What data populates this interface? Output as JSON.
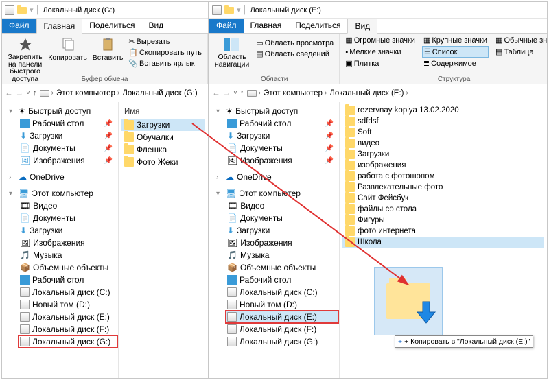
{
  "win1": {
    "title": "Локальный диск (G:)",
    "tabs": {
      "file": "Файл",
      "home": "Главная",
      "share": "Поделиться",
      "view": "Вид"
    },
    "ribbon": {
      "pin": "Закрепить на панели\nбыстрого доступа",
      "copy": "Копировать",
      "paste": "Вставить",
      "cut": "Вырезать",
      "copypath": "Скопировать путь",
      "pasteshortcut": "Вставить ярлык",
      "group1": "Буфер обмена"
    },
    "crumb": {
      "pc": "Этот компьютер",
      "drive": "Локальный диск (G:)"
    },
    "tree": {
      "quick": "Быстрый доступ",
      "desktop": "Рабочий стол",
      "downloads": "Загрузки",
      "documents": "Документы",
      "pictures": "Изображения",
      "onedrive": "OneDrive",
      "thispc": "Этот компьютер",
      "video": "Видео",
      "tdocs": "Документы",
      "tdl": "Загрузки",
      "tpic": "Изображения",
      "music": "Музыка",
      "obj": "Объемные объекты",
      "desk2": "Рабочий стол",
      "c": "Локальный диск (C:)",
      "d": "Новый том (D:)",
      "e": "Локальный диск (E:)",
      "f": "Локальный диск (F:)",
      "g": "Локальный диск (G:)"
    },
    "colheader": "Имя",
    "files": {
      "f1": "Загрузки",
      "f2": "Обучалки",
      "f3": "Флешка",
      "f4": "Фото Жеки"
    }
  },
  "win2": {
    "title": "Локальный диск (E:)",
    "tabs": {
      "file": "Файл",
      "home": "Главная",
      "share": "Поделиться",
      "view": "Вид"
    },
    "ribbon": {
      "navpane": "Область\nнавигации",
      "preview": "Область просмотра",
      "details": "Область сведений",
      "grp_areas": "Области",
      "huge": "Огромные значки",
      "large": "Крупные значки",
      "normal": "Обычные значки",
      "small": "Мелкие значки",
      "list": "Список",
      "table": "Таблица",
      "tiles": "Плитка",
      "content": "Содержимое",
      "grp_struct": "Структура"
    },
    "crumb": {
      "pc": "Этот компьютер",
      "drive": "Локальный диск (E:)"
    },
    "tree": {
      "quick": "Быстрый доступ",
      "desktop": "Рабочий стол",
      "downloads": "Загрузки",
      "documents": "Документы",
      "pictures": "Изображения",
      "onedrive": "OneDrive",
      "thispc": "Этот компьютер",
      "video": "Видео",
      "tdocs": "Документы",
      "tdl": "Загрузки",
      "tpic": "Изображения",
      "music": "Музыка",
      "obj": "Объемные объекты",
      "desk2": "Рабочий стол",
      "c": "Локальный диск (C:)",
      "d": "Новый том (D:)",
      "e": "Локальный диск (E:)",
      "f": "Локальный диск (F:)",
      "g": "Локальный диск (G:)"
    },
    "files": {
      "a": "rezervnay kopiya 13.02.2020",
      "b": "sdfdsf",
      "c": "Soft",
      "d": "видео",
      "e": "Загрузки",
      "f": "изображения",
      "g": "работа с фотошопом",
      "h": "Развлекательные фото",
      "i": "Сайт Фейсбук",
      "j": "файлы со стола",
      "k": "Фигуры",
      "l": "фото интернета",
      "m": "Школа"
    },
    "tooltip": "+ Копировать в \"Локальный диск (E:)\""
  }
}
